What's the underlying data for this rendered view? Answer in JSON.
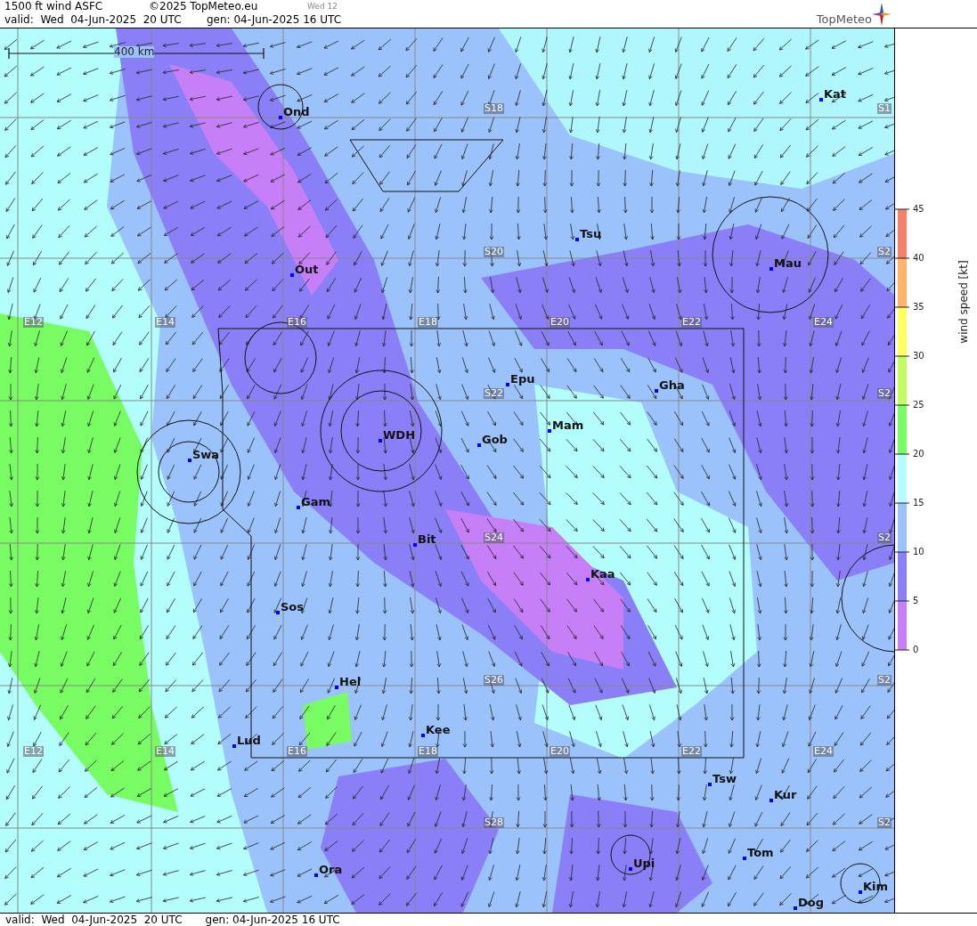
{
  "header": {
    "title": "1500 ft wind ASFC",
    "copyright": "©2025 TopMeteo.eu",
    "day_badge": "Wed 12",
    "valid": "valid:  Wed  04-Jun-2025  20 UTC",
    "generated": "gen: 04-Jun-2025 16 UTC",
    "logo": "TopMeteo"
  },
  "map": {
    "scale": "400 km",
    "places": [
      "Ond",
      "Kat",
      "Tsu",
      "Out",
      "Mau",
      "Epu",
      "Gha",
      "Mam",
      "WDH",
      "Gob",
      "Swa",
      "Gam",
      "Bit",
      "Kaa",
      "Sos",
      "Hel",
      "Kee",
      "Lud",
      "Tsw",
      "Kur",
      "Tom",
      "Upi",
      "Ora",
      "Kim",
      "Dog"
    ],
    "grid_labels": [
      "S18",
      "S1",
      "S20",
      "S2",
      "E12",
      "E14",
      "E16",
      "E18",
      "E20",
      "E22",
      "E24",
      "S22",
      "S2",
      "S24",
      "S2",
      "S26",
      "S2",
      "E12",
      "E14",
      "E16",
      "E18",
      "E20",
      "E22",
      "E24",
      "S28",
      "S2"
    ]
  },
  "legend": {
    "title": "wind speed [kt]",
    "ticks": [
      "45",
      "40",
      "35",
      "30",
      "25",
      "20",
      "15",
      "10",
      "5",
      "0"
    ],
    "bands": [
      {
        "color": "#f47f6b"
      },
      {
        "color": "#ffb36b"
      },
      {
        "color": "#ffff63"
      },
      {
        "color": "#c3fb63"
      },
      {
        "color": "#79fb63"
      },
      {
        "color": "#b3fdfd"
      },
      {
        "color": "#9cc2fb"
      },
      {
        "color": "#8b7ff7"
      },
      {
        "color": "#c77ff7"
      }
    ]
  },
  "footer": {
    "valid": "valid:  Wed  04-Jun-2025  20 UTC",
    "generated": "gen: 04-Jun-2025 16 UTC"
  }
}
